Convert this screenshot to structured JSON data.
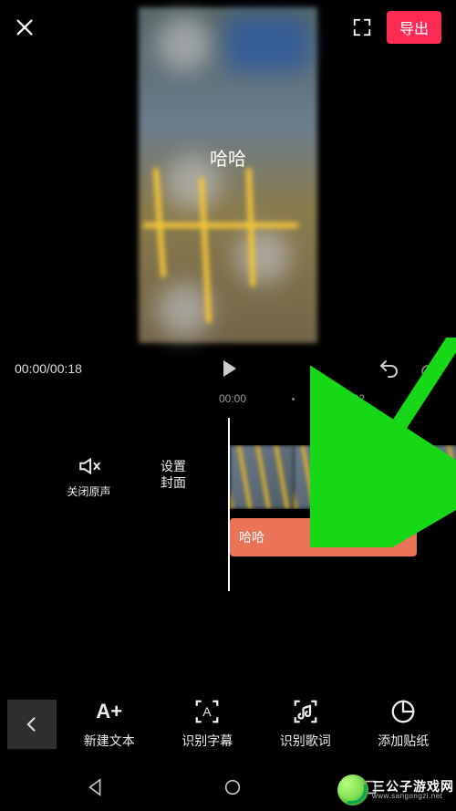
{
  "topbar": {
    "export_label": "导出"
  },
  "preview": {
    "overlay_text": "哈哈"
  },
  "playrow": {
    "time_text": "00:00/00:18"
  },
  "ruler": {
    "t0": "00:00",
    "t2": "00:02"
  },
  "timeline": {
    "mute_label": "关闭原声",
    "cover_line1": "设置",
    "cover_line2": "封面",
    "text_clip_label": "哈哈",
    "add_label": "+"
  },
  "toolbar": {
    "new_text": "新建文本",
    "new_text_icon": "A+",
    "detect_caption": "识别字幕",
    "detect_lyrics": "识别歌词",
    "add_sticker": "添加贴纸"
  },
  "watermark": {
    "line1": "三公子游戏网",
    "line2": "www.sangongzi.net"
  }
}
